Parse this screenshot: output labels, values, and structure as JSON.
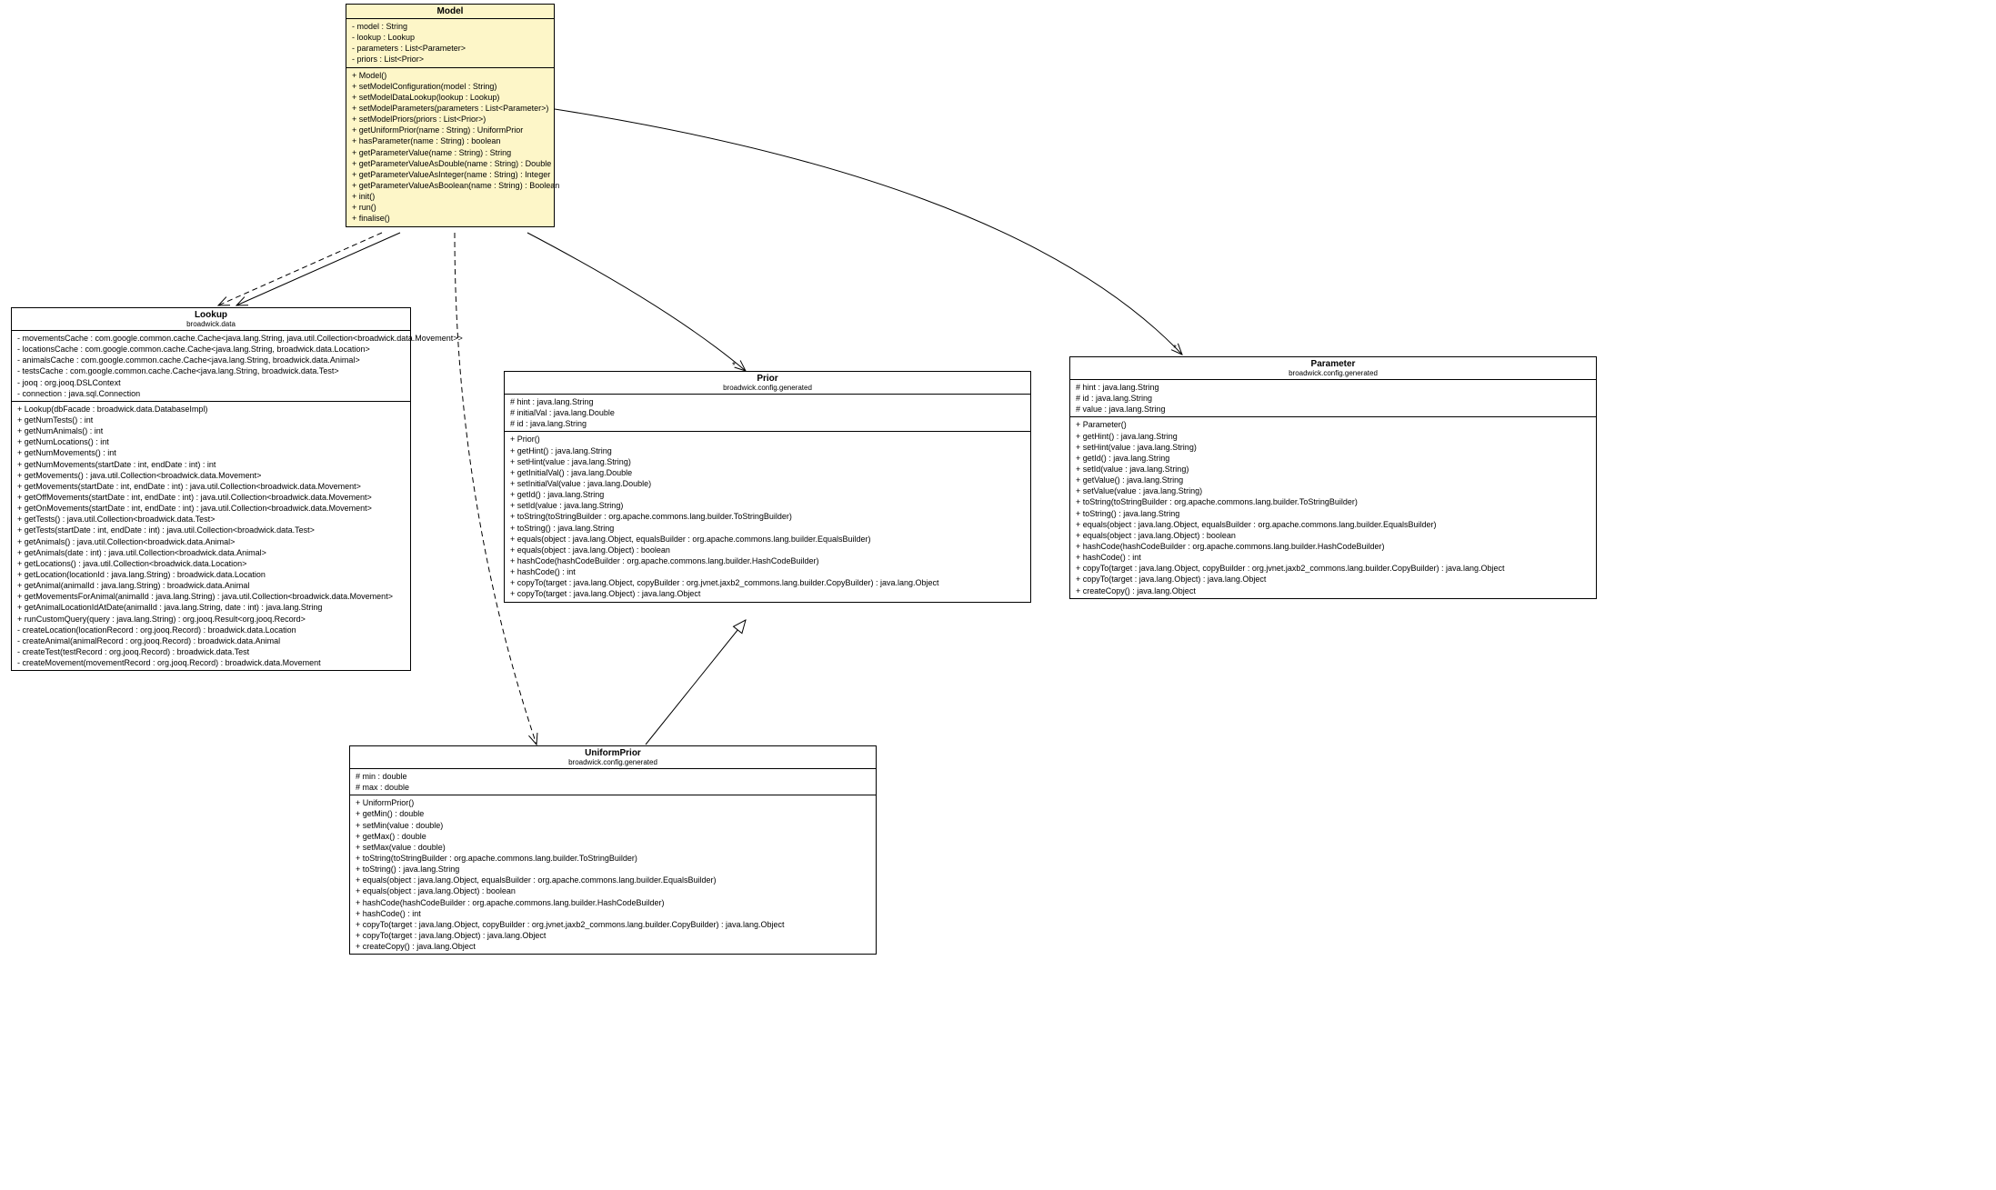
{
  "classes": {
    "model": {
      "name": "Model",
      "pkg": "",
      "attrs": [
        "- model : String",
        "- lookup : Lookup",
        "- parameters : List<Parameter>",
        "- priors : List<Prior>"
      ],
      "ops": [
        "+ Model()",
        "+ setModelConfiguration(model : String)",
        "+ setModelDataLookup(lookup : Lookup)",
        "+ setModelParameters(parameters : List<Parameter>)",
        "+ setModelPriors(priors : List<Prior>)",
        "+ getUniformPrior(name : String) : UniformPrior",
        "+ hasParameter(name : String) : boolean",
        "+ getParameterValue(name : String) : String",
        "+ getParameterValueAsDouble(name : String) : Double",
        "+ getParameterValueAsInteger(name : String) : Integer",
        "+ getParameterValueAsBoolean(name : String) : Boolean",
        "+ init()",
        "+ run()",
        "+ finalise()"
      ]
    },
    "lookup": {
      "name": "Lookup",
      "pkg": "broadwick.data",
      "attrs": [
        "- movementsCache : com.google.common.cache.Cache<java.lang.String, java.util.Collection<broadwick.data.Movement>>",
        "- locationsCache : com.google.common.cache.Cache<java.lang.String, broadwick.data.Location>",
        "- animalsCache : com.google.common.cache.Cache<java.lang.String, broadwick.data.Animal>",
        "- testsCache : com.google.common.cache.Cache<java.lang.String, broadwick.data.Test>",
        "- jooq : org.jooq.DSLContext",
        "- connection : java.sql.Connection"
      ],
      "ops": [
        "+ Lookup(dbFacade : broadwick.data.DatabaseImpl)",
        "+ getNumTests() : int",
        "+ getNumAnimals() : int",
        "+ getNumLocations() : int",
        "+ getNumMovements() : int",
        "+ getNumMovements(startDate : int, endDate : int) : int",
        "+ getMovements() : java.util.Collection<broadwick.data.Movement>",
        "+ getMovements(startDate : int, endDate : int) : java.util.Collection<broadwick.data.Movement>",
        "+ getOffMovements(startDate : int, endDate : int) : java.util.Collection<broadwick.data.Movement>",
        "+ getOnMovements(startDate : int, endDate : int) : java.util.Collection<broadwick.data.Movement>",
        "+ getTests() : java.util.Collection<broadwick.data.Test>",
        "+ getTests(startDate : int, endDate : int) : java.util.Collection<broadwick.data.Test>",
        "+ getAnimals() : java.util.Collection<broadwick.data.Animal>",
        "+ getAnimals(date : int) : java.util.Collection<broadwick.data.Animal>",
        "+ getLocations() : java.util.Collection<broadwick.data.Location>",
        "+ getLocation(locationId : java.lang.String) : broadwick.data.Location",
        "+ getAnimal(animalId : java.lang.String) : broadwick.data.Animal",
        "+ getMovementsForAnimal(animalId : java.lang.String) : java.util.Collection<broadwick.data.Movement>",
        "+ getAnimalLocationIdAtDate(animalId : java.lang.String, date : int) : java.lang.String",
        "+ runCustomQuery(query : java.lang.String) : org.jooq.Result<org.jooq.Record>",
        "- createLocation(locationRecord : org.jooq.Record) : broadwick.data.Location",
        "- createAnimal(animalRecord : org.jooq.Record) : broadwick.data.Animal",
        "- createTest(testRecord : org.jooq.Record) : broadwick.data.Test",
        "- createMovement(movementRecord : org.jooq.Record) : broadwick.data.Movement"
      ]
    },
    "prior": {
      "name": "Prior",
      "pkg": "broadwick.config.generated",
      "attrs": [
        "# hint : java.lang.String",
        "# initialVal : java.lang.Double",
        "# id : java.lang.String"
      ],
      "ops": [
        "+ Prior()",
        "+ getHint() : java.lang.String",
        "+ setHint(value : java.lang.String)",
        "+ getInitialVal() : java.lang.Double",
        "+ setInitialVal(value : java.lang.Double)",
        "+ getId() : java.lang.String",
        "+ setId(value : java.lang.String)",
        "+ toString(toStringBuilder : org.apache.commons.lang.builder.ToStringBuilder)",
        "+ toString() : java.lang.String",
        "+ equals(object : java.lang.Object, equalsBuilder : org.apache.commons.lang.builder.EqualsBuilder)",
        "+ equals(object : java.lang.Object) : boolean",
        "+ hashCode(hashCodeBuilder : org.apache.commons.lang.builder.HashCodeBuilder)",
        "+ hashCode() : int",
        "+ copyTo(target : java.lang.Object, copyBuilder : org.jvnet.jaxb2_commons.lang.builder.CopyBuilder) : java.lang.Object",
        "+ copyTo(target : java.lang.Object) : java.lang.Object"
      ]
    },
    "parameter": {
      "name": "Parameter",
      "pkg": "broadwick.config.generated",
      "attrs": [
        "# hint : java.lang.String",
        "# id : java.lang.String",
        "# value : java.lang.String"
      ],
      "ops": [
        "+ Parameter()",
        "+ getHint() : java.lang.String",
        "+ setHint(value : java.lang.String)",
        "+ getId() : java.lang.String",
        "+ setId(value : java.lang.String)",
        "+ getValue() : java.lang.String",
        "+ setValue(value : java.lang.String)",
        "+ toString(toStringBuilder : org.apache.commons.lang.builder.ToStringBuilder)",
        "+ toString() : java.lang.String",
        "+ equals(object : java.lang.Object, equalsBuilder : org.apache.commons.lang.builder.EqualsBuilder)",
        "+ equals(object : java.lang.Object) : boolean",
        "+ hashCode(hashCodeBuilder : org.apache.commons.lang.builder.HashCodeBuilder)",
        "+ hashCode() : int",
        "+ copyTo(target : java.lang.Object, copyBuilder : org.jvnet.jaxb2_commons.lang.builder.CopyBuilder) : java.lang.Object",
        "+ copyTo(target : java.lang.Object) : java.lang.Object",
        "+ createCopy() : java.lang.Object"
      ]
    },
    "uniformprior": {
      "name": "UniformPrior",
      "pkg": "broadwick.config.generated",
      "attrs": [
        "# min : double",
        "# max : double"
      ],
      "ops": [
        "+ UniformPrior()",
        "+ getMin() : double",
        "+ setMin(value : double)",
        "+ getMax() : double",
        "+ setMax(value : double)",
        "+ toString(toStringBuilder : org.apache.commons.lang.builder.ToStringBuilder)",
        "+ toString() : java.lang.String",
        "+ equals(object : java.lang.Object, equalsBuilder : org.apache.commons.lang.builder.EqualsBuilder)",
        "+ equals(object : java.lang.Object) : boolean",
        "+ hashCode(hashCodeBuilder : org.apache.commons.lang.builder.HashCodeBuilder)",
        "+ hashCode() : int",
        "+ copyTo(target : java.lang.Object, copyBuilder : org.jvnet.jaxb2_commons.lang.builder.CopyBuilder) : java.lang.Object",
        "+ copyTo(target : java.lang.Object) : java.lang.Object",
        "+ createCopy() : java.lang.Object"
      ]
    }
  },
  "multiplicity_star": "*"
}
